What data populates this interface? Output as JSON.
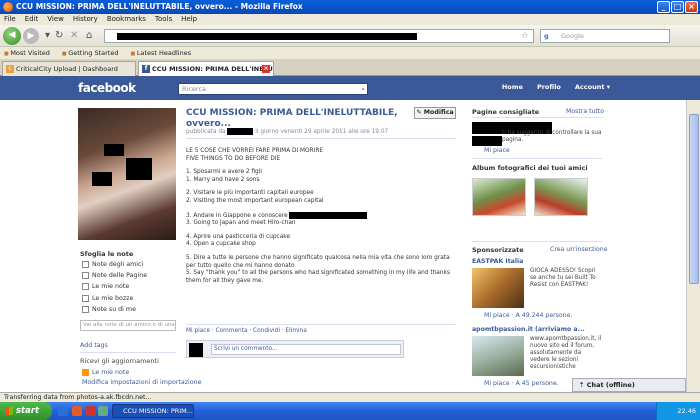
{
  "window": {
    "title": "CCU MISSION: PRIMA DELL'INELUTTABILE, ovvero... - Mozilla Firefox"
  },
  "menu": [
    "File",
    "Edit",
    "View",
    "History",
    "Bookmarks",
    "Tools",
    "Help"
  ],
  "search_placeholder": "Google",
  "bookmarks": [
    "Most Visited",
    "Getting Started",
    "Latest Headlines"
  ],
  "tabs": [
    {
      "label": "CriticalCity Upload | Dashboard",
      "active": false
    },
    {
      "label": "CCU MISSION: PRIMA DELL'INELUT...",
      "active": true
    }
  ],
  "fb": {
    "logo": "facebook",
    "search_placeholder": "Ricerca",
    "nav": [
      "Home",
      "Profilo",
      "Account ▾"
    ]
  },
  "sidebar": {
    "notes_title": "Sfoglia le note",
    "notes": [
      "Note degli amici",
      "Note delle Pagine",
      "Le mie note",
      "Le mie bozze",
      "Note su di me"
    ],
    "search_placeholder": "Vai alle note di un amico o di una P",
    "add_tags": "Add tags",
    "updates_title": "Ricevi gli aggiornamenti",
    "my_notes": "Le mie note",
    "import_settings": "Modifica impostazioni di importazione"
  },
  "note": {
    "title": "CCU MISSION: PRIMA DELL'INELUTTABILE, ovvero...",
    "edit": "Modifica",
    "meta_pre": "pubblicata da",
    "meta_post": "il giorno venerdi 29 aprile 2011 alle ore 19.07",
    "heading1": "LE 5 COSE CHE VORREI FARE PRIMA DI MORIRE",
    "heading2": "FIVE THINGS TO DO BEFORE DIE",
    "l1a": "1. Sposarmi e avere 2 figli",
    "l1b": "1. Marry and have 2 sons",
    "l2a": "2. Visitare le più importanti capitali europee",
    "l2b": "2. Visiting the most important european capital",
    "l3a": "3. Andare in Giappone e conoscere",
    "l3b": "3. Going to Japan and meet Hiro-chan",
    "l4a": "4. Aprire una pasticceria di cupcake",
    "l4b": "4. Open a cupcake shop",
    "l5a": "5. Dire a tutte le persone che hanno significato qualcosa nella mia vita che sono loro grata per tutto quello che mi hanno donato",
    "l5b": "5. Say \"thank you\" to all the persons who had significated something in my life and thanks them for all they gave me.",
    "actions": "Mi piace · Commenta · Condividi · Elimina",
    "comment_placeholder": "Scrivi un commento..."
  },
  "right": {
    "pages_title": "Pagine consigliate",
    "pages_all": "Mostra tutto",
    "pages_text": "ti ha suggerito di controllare la sua pagina.",
    "pages_like": "Mi piace",
    "albums_title": "Album fotografici dei tuoi amici",
    "sponsored_title": "Sponsorizzate",
    "sponsored_create": "Crea un'inserzione",
    "ad1_title": "EASTPAK Italia",
    "ad1_text": "GIOCA ADESSO! Scopri se anche tu sei Built To Resist con EASTPAK!",
    "ad1_like": "Mi piace · A 49.244 persone.",
    "ad2_title": "apomtbpassion.it (arriviamo a...",
    "ad2_text": "www.apomtbpassion.it, il nuovo sito ed il forum, assolutamente da vedere le sezioni escursionistiche",
    "ad2_like": "Mi piace · A 45 persone.",
    "chat": "Chat (offline)"
  },
  "status": "Transferring data from photos-a.ak.fbcdn.net...",
  "taskbar": {
    "start": "start",
    "task": "CCU MISSION: PRIM...",
    "clock": "22.46"
  }
}
